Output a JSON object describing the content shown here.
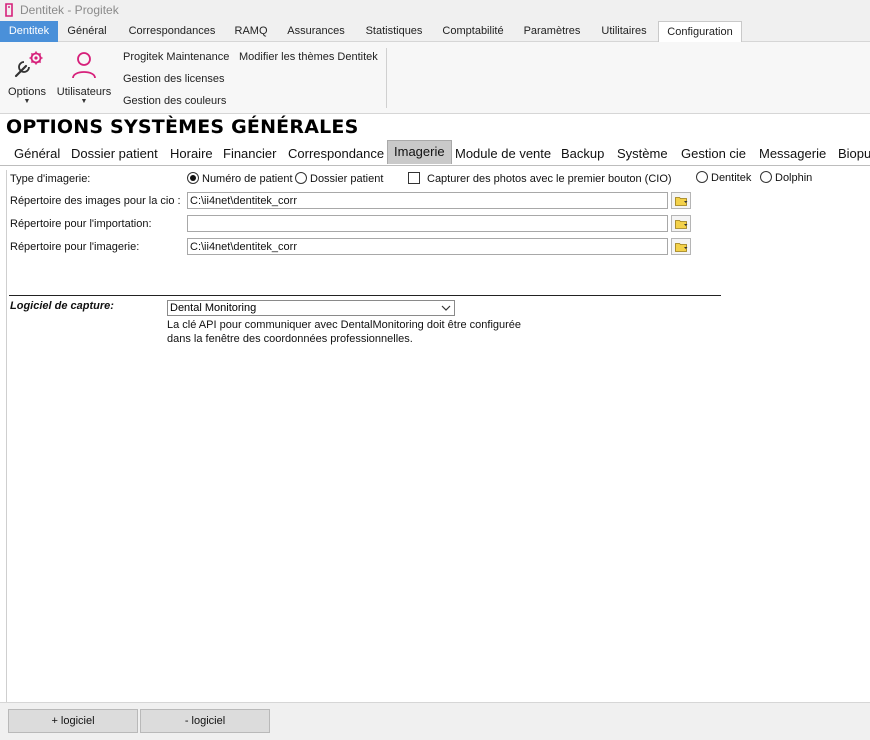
{
  "window": {
    "title": "Dentitek - Progitek"
  },
  "ribbon_tabs": [
    {
      "label": "Dentitek"
    },
    {
      "label": "Général"
    },
    {
      "label": "Correspondances"
    },
    {
      "label": "RAMQ"
    },
    {
      "label": "Assurances"
    },
    {
      "label": "Statistiques"
    },
    {
      "label": "Comptabilité"
    },
    {
      "label": "Paramètres"
    },
    {
      "label": "Utilitaires"
    },
    {
      "label": "Configuration"
    }
  ],
  "ribbon": {
    "options_label": "Options",
    "users_label": "Utilisateurs",
    "links": {
      "maintenance": "Progitek Maintenance",
      "themes": "Modifier les thèmes Dentitek",
      "licenses": "Gestion des licenses",
      "colors": "Gestion des couleurs"
    }
  },
  "page": {
    "title": "OPTIONS SYSTÈMES GÉNÉRALES"
  },
  "subtabs": [
    {
      "label": "Général"
    },
    {
      "label": "Dossier patient"
    },
    {
      "label": "Horaire"
    },
    {
      "label": "Financier"
    },
    {
      "label": "Correspondance"
    },
    {
      "label": "Imagerie"
    },
    {
      "label": "Module de vente"
    },
    {
      "label": "Backup"
    },
    {
      "label": "Système"
    },
    {
      "label": "Gestion cie"
    },
    {
      "label": "Messagerie"
    },
    {
      "label": "Biopu"
    }
  ],
  "form": {
    "imaging_type_label": "Type d'imagerie:",
    "radio_patient_number": "Numéro de patient",
    "radio_patient_file": "Dossier patient",
    "capture_checkbox_label": "Capturer des photos avec le premier bouton (CIO)",
    "radio_dentitek": "Dentitek",
    "radio_dolphin": "Dolphin",
    "cio_dir_label": "Répertoire des images pour la cio :",
    "cio_dir_value": "C:\\ii4net\\dentitek_corr",
    "import_dir_label": "Répertoire pour l'importation:",
    "import_dir_value": "",
    "imaging_dir_label": "Répertoire pour l'imagerie:",
    "imaging_dir_value": "C:\\ii4net\\dentitek_corr"
  },
  "capture": {
    "label": "Logiciel de capture:",
    "selected": "Dental Monitoring",
    "note_line1": "La clé API pour communiquer avec DentalMonitoring doit être configurée",
    "note_line2": "dans la fenêtre des coordonnées professionnelles."
  },
  "bottom": {
    "add_label": "+ logiciel",
    "remove_label": "- logiciel"
  },
  "colors": {
    "app_tab": "#4a90d9",
    "accent_icon": "#d6207a"
  }
}
